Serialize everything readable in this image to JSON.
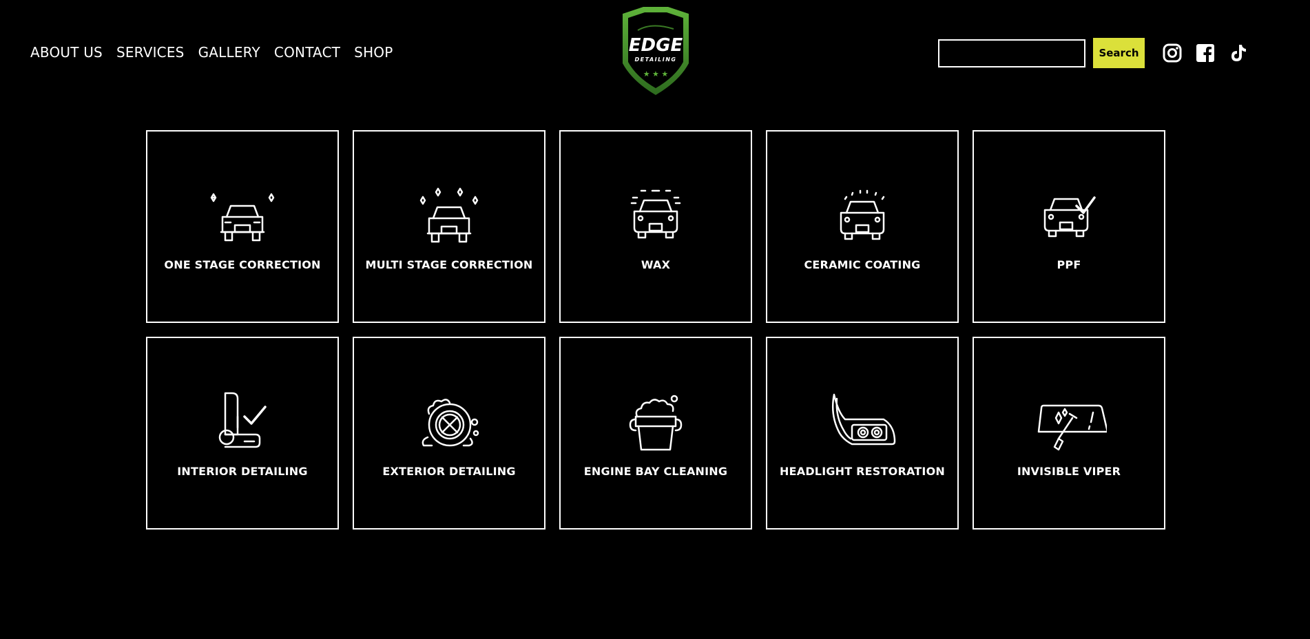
{
  "nav": {
    "items": [
      {
        "label": "ABOUT US"
      },
      {
        "label": "SERVICES"
      },
      {
        "label": "GALLERY"
      },
      {
        "label": "CONTACT"
      },
      {
        "label": "SHOP"
      }
    ]
  },
  "logo": {
    "text_main": "EDGE",
    "text_sub": "DETAILING",
    "colors": {
      "shield": "#4a9a2a",
      "shield_dark": "#1f4a18"
    }
  },
  "search": {
    "value": "",
    "placeholder": "",
    "button_label": "Search",
    "button_color": "#dbe03a"
  },
  "social": {
    "icons": [
      "instagram-icon",
      "facebook-icon",
      "tiktok-icon"
    ]
  },
  "services": [
    {
      "label": "ONE STAGE CORRECTION",
      "icon": "car-sparkle-icon"
    },
    {
      "label": "MULTI STAGE CORRECTION",
      "icon": "car-multi-sparkle-icon"
    },
    {
      "label": "WAX",
      "icon": "car-wax-icon"
    },
    {
      "label": "CERAMIC COATING",
      "icon": "car-ceramic-icon"
    },
    {
      "label": "PPF",
      "icon": "car-check-icon"
    },
    {
      "label": "INTERIOR DETAILING",
      "icon": "seat-check-icon"
    },
    {
      "label": "EXTERIOR DETAILING",
      "icon": "wheel-foam-icon"
    },
    {
      "label": "ENGINE BAY CLEANING",
      "icon": "bucket-foam-icon"
    },
    {
      "label": "HEADLIGHT RESTORATION",
      "icon": "headlight-icon"
    },
    {
      "label": "INVISIBLE VIPER",
      "icon": "windshield-wiper-icon"
    }
  ]
}
